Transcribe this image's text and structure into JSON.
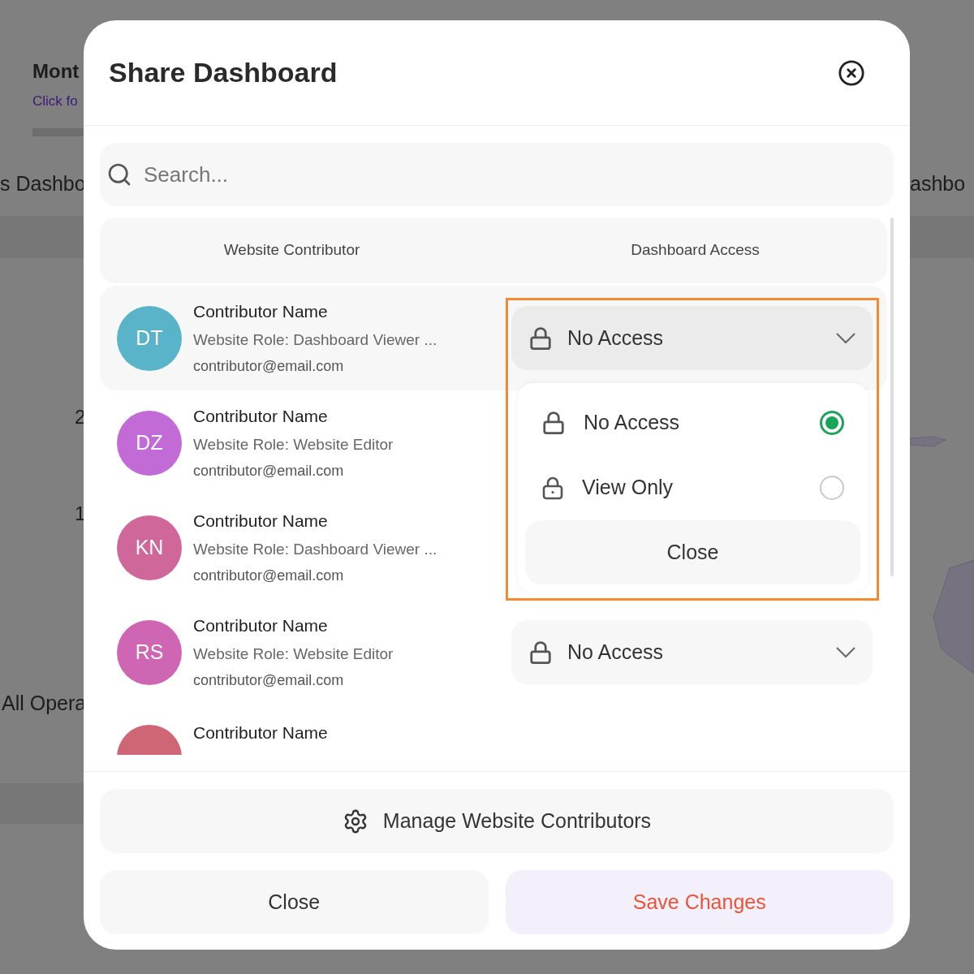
{
  "background": {
    "title": "Mont",
    "link": "Click fo",
    "left_heading": "s Dashbo",
    "right_heading": "ashbo",
    "axis_labels": [
      "2",
      "1"
    ],
    "section": "All Opera"
  },
  "dialog": {
    "title": "Share Dashboard",
    "search": {
      "placeholder": "Search..."
    },
    "columns": [
      "Website Contributor",
      "Dashboard Access"
    ],
    "rows": [
      {
        "initials": "DT",
        "color": "#5ab4c9",
        "name": "Contributor Name",
        "role": "Website Role: Dashboard Viewer ...",
        "email": "contributor@email.com",
        "access": "No Access",
        "expanded": true,
        "highlighted": true
      },
      {
        "initials": "DZ",
        "color": "#c26ad6",
        "name": "Contributor Name",
        "role": "Website Role: Website Editor",
        "email": "contributor@email.com",
        "expanded": false,
        "highlighted": false
      },
      {
        "initials": "KN",
        "color": "#d0679a",
        "name": "Contributor Name",
        "role": "Website Role: Dashboard Viewer ...",
        "email": "contributor@email.com",
        "expanded": false,
        "highlighted": false
      },
      {
        "initials": "RS",
        "color": "#cf66b3",
        "name": "Contributor Name",
        "role": "Website Role: Website Editor",
        "email": "contributor@email.com",
        "access": "No Access",
        "expanded": false,
        "highlighted": false
      },
      {
        "color": "#cf6676",
        "name": "Contributor Name",
        "expanded": false,
        "highlighted": false
      }
    ],
    "access_menu": {
      "options": [
        {
          "kind": "locked",
          "label": "No Access",
          "selected": true
        },
        {
          "kind": "view",
          "label": "View Only",
          "selected": false
        }
      ],
      "close_label": "Close"
    },
    "manage_button": "Manage Website Contributors",
    "buttons": [
      {
        "kind": "secondary",
        "label": "Close"
      },
      {
        "kind": "primary",
        "label": "Save Changes"
      }
    ]
  }
}
